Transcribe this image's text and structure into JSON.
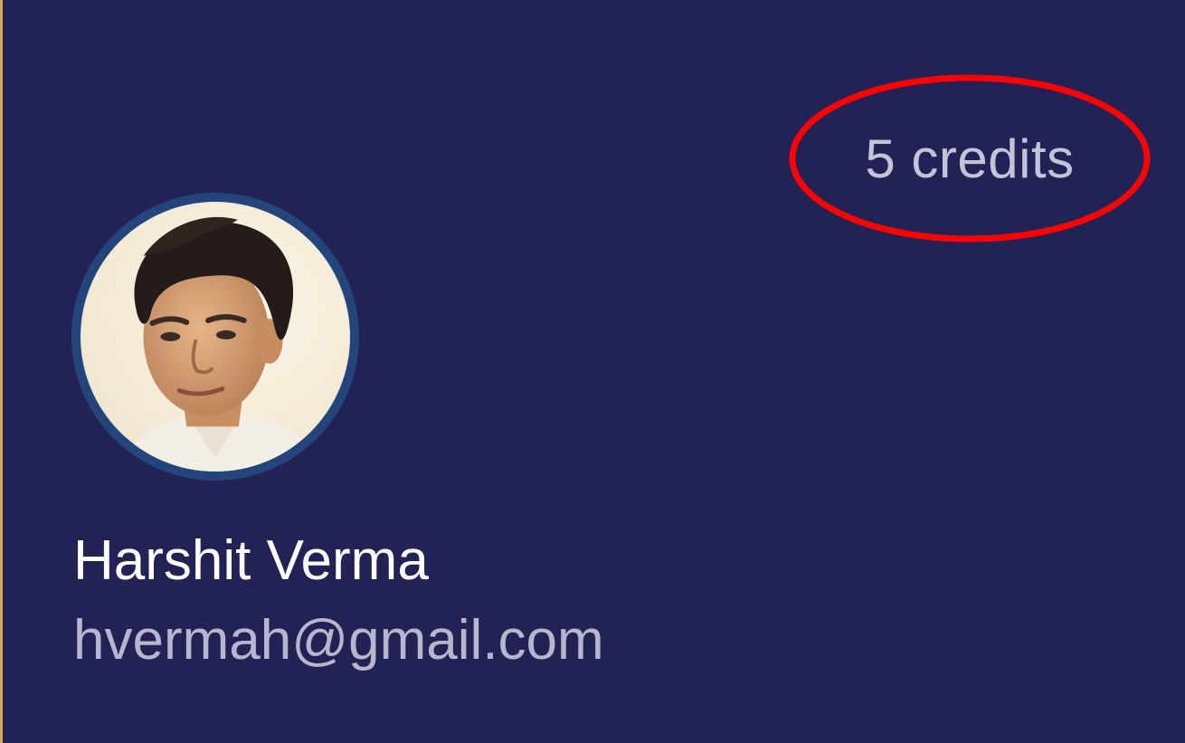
{
  "profile_header": {
    "credits_label": "5 credits",
    "user_name": "Harshit Verma",
    "user_email": "hvermah@gmail.com",
    "avatar_icon": "user-photo"
  },
  "colors": {
    "background": "#232255",
    "avatar_ring": "#24447c",
    "annotation": "#ff0000",
    "name_text": "#ffffff",
    "secondary_text": "#b7b6cf"
  }
}
